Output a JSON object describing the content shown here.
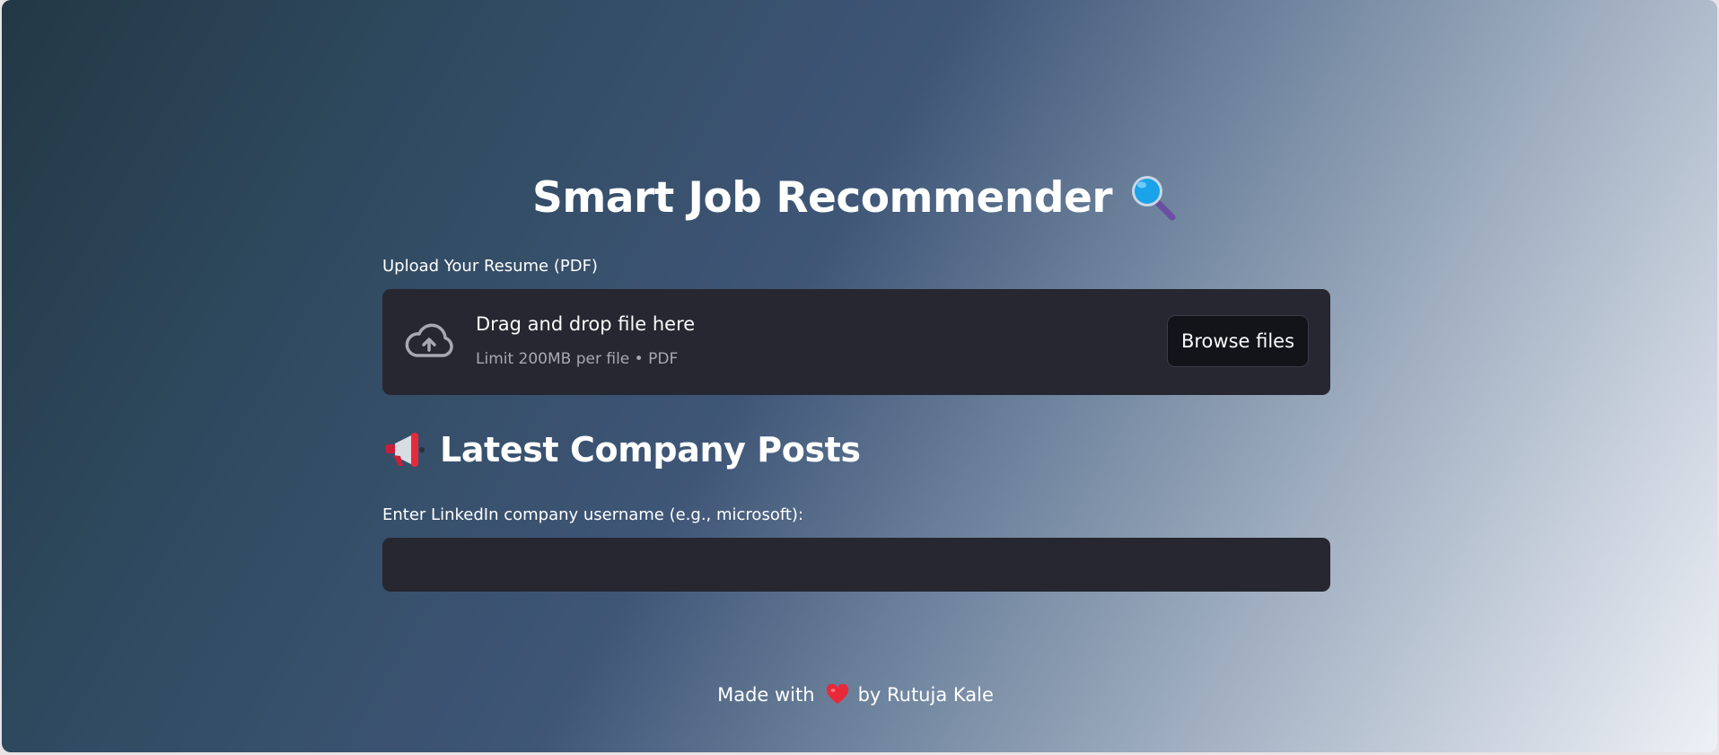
{
  "header": {
    "title": "Smart Job Recommender",
    "title_icon": "magnifying-glass-icon"
  },
  "upload": {
    "label": "Upload Your Resume (PDF)",
    "drop_title": "Drag and drop file here",
    "drop_subtitle": "Limit 200MB per file • PDF",
    "browse_label": "Browse files",
    "icon": "cloud-upload-icon"
  },
  "posts": {
    "section_title": "Latest Company Posts",
    "section_icon": "megaphone-icon",
    "input_label": "Enter LinkedIn company username (e.g., microsoft):",
    "input_value": "",
    "input_placeholder": ""
  },
  "footer": {
    "prefix": "Made with",
    "icon": "heart-icon",
    "suffix": "by Rutuja Kale"
  },
  "colors": {
    "panel": "#262730",
    "button_bg": "#121419",
    "text": "#ffffff",
    "muted_text": "#a6a8b3",
    "heart": "#e8293a"
  }
}
